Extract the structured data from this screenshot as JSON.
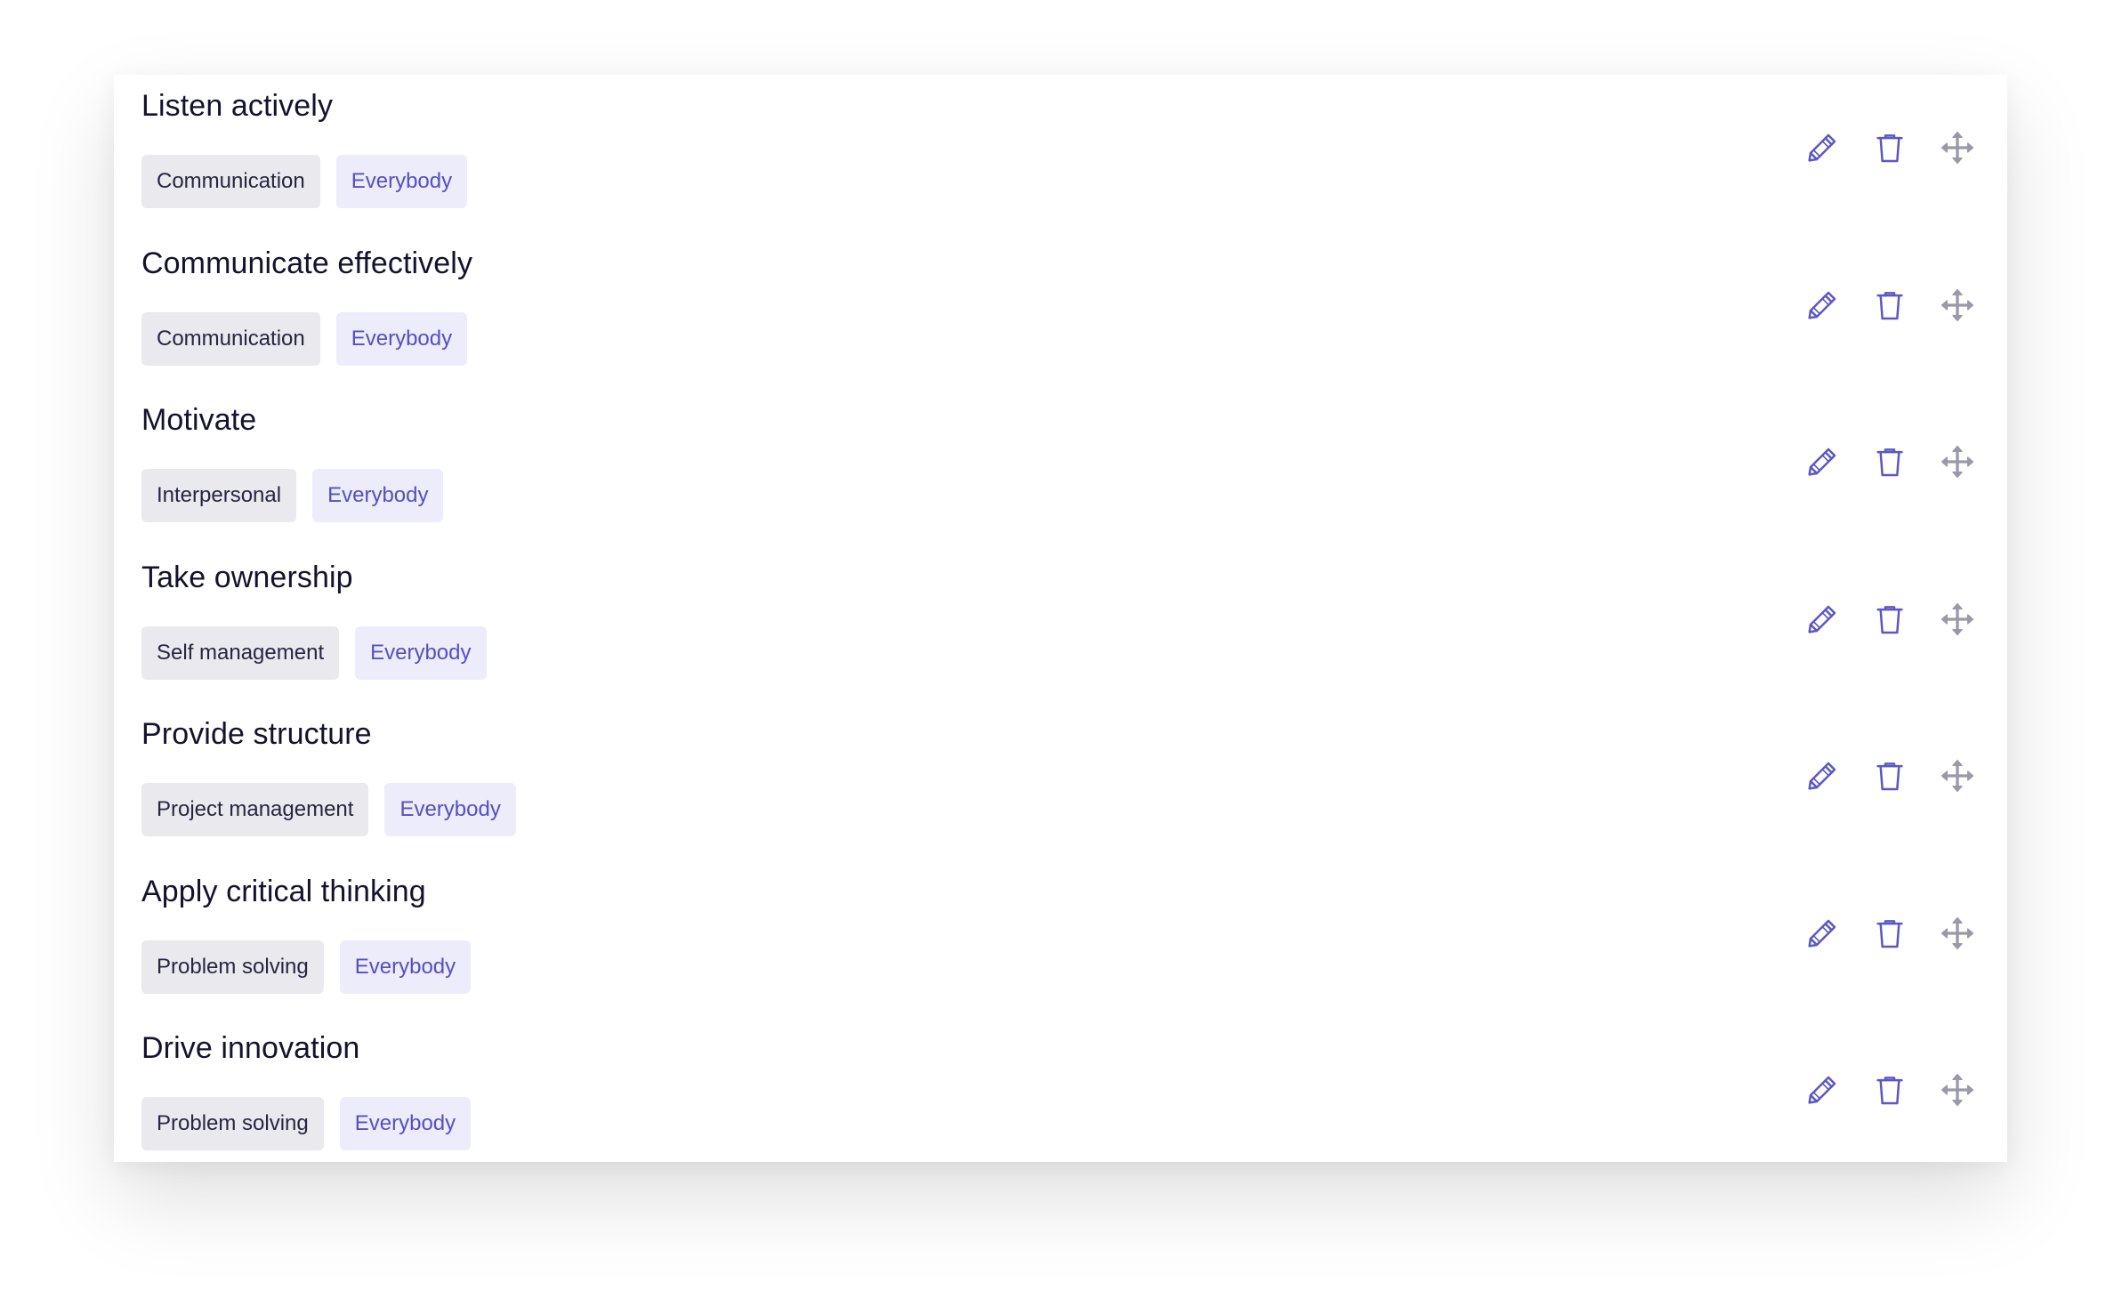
{
  "items": [
    {
      "title": "Listen actively",
      "category": "Communication",
      "audience": "Everybody"
    },
    {
      "title": "Communicate effectively",
      "category": "Communication",
      "audience": "Everybody"
    },
    {
      "title": "Motivate",
      "category": "Interpersonal",
      "audience": "Everybody"
    },
    {
      "title": "Take ownership",
      "category": "Self management",
      "audience": "Everybody"
    },
    {
      "title": "Provide structure",
      "category": "Project management",
      "audience": "Everybody"
    },
    {
      "title": "Apply critical thinking",
      "category": "Problem solving",
      "audience": "Everybody"
    },
    {
      "title": "Drive innovation",
      "category": "Problem solving",
      "audience": "Everybody"
    }
  ],
  "icons": {
    "edit": "pencil-icon",
    "delete": "trash-icon",
    "move": "move-icon"
  },
  "colors": {
    "title_text": "#14122e",
    "category_bg": "#e9e9ee",
    "category_text": "#272640",
    "audience_bg": "#ececfb",
    "audience_text": "#5550c2",
    "action_icon": "#5b57c6",
    "move_icon": "#9a99a8"
  }
}
